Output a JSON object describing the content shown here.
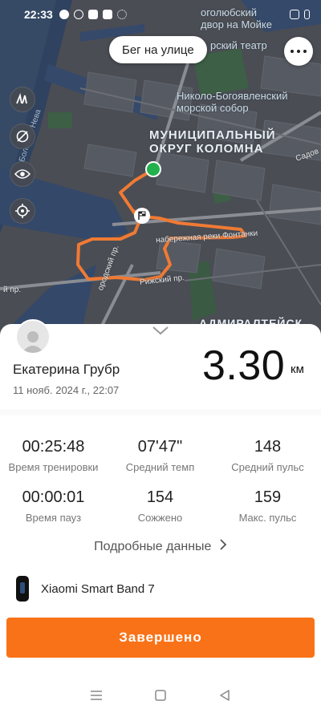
{
  "status_bar": {
    "time": "22:33",
    "left_icons": [
      "message-icon",
      "yandex-icon",
      "youtube-icon",
      "shield-icon",
      "app-grid-icon"
    ],
    "right_icons": [
      "nfc-icon",
      "vibrate-icon"
    ]
  },
  "map": {
    "labels": {
      "district": "МУНИЦИПАЛЬНЫЙ\nОКРУГ КОЛОМНА",
      "cathedral": "Николо-Богоявленский\nморской собор",
      "theatre": "рский театр",
      "top_right": "оголюбский\nдвор на Мойке",
      "fontanka": "набережная реки Фонтанки",
      "rizhsky": "Рижский пр.",
      "left_pr": "й пр.",
      "diagonal": "ородский пр.",
      "sadov": "Садов",
      "neva": "Большая Нева",
      "admiralty": "АДМИРАЛТЕЙСК"
    },
    "route_color": "#f07a34",
    "start_color": "#22b14c"
  },
  "header": {
    "activity_type": "Бег на улице"
  },
  "workout": {
    "user_name": "Екатерина Грубр",
    "date": "11 нояб. 2024 г., 22:07",
    "distance": "3.30",
    "distance_unit": "км",
    "stats": [
      {
        "value": "00:25:48",
        "label": "Время тренировки"
      },
      {
        "value": "07'47\"",
        "label": "Средний темп"
      },
      {
        "value": "148",
        "label": "Средний пульс"
      },
      {
        "value": "00:00:01",
        "label": "Время пауз"
      },
      {
        "value": "154",
        "label": "Сожжено"
      },
      {
        "value": "159",
        "label": "Макс. пульс"
      }
    ],
    "details_link": "Подробные данные",
    "device_name": "Xiaomi Smart Band 7",
    "finish_button": "Завершено"
  },
  "accent_color": "#f97218"
}
